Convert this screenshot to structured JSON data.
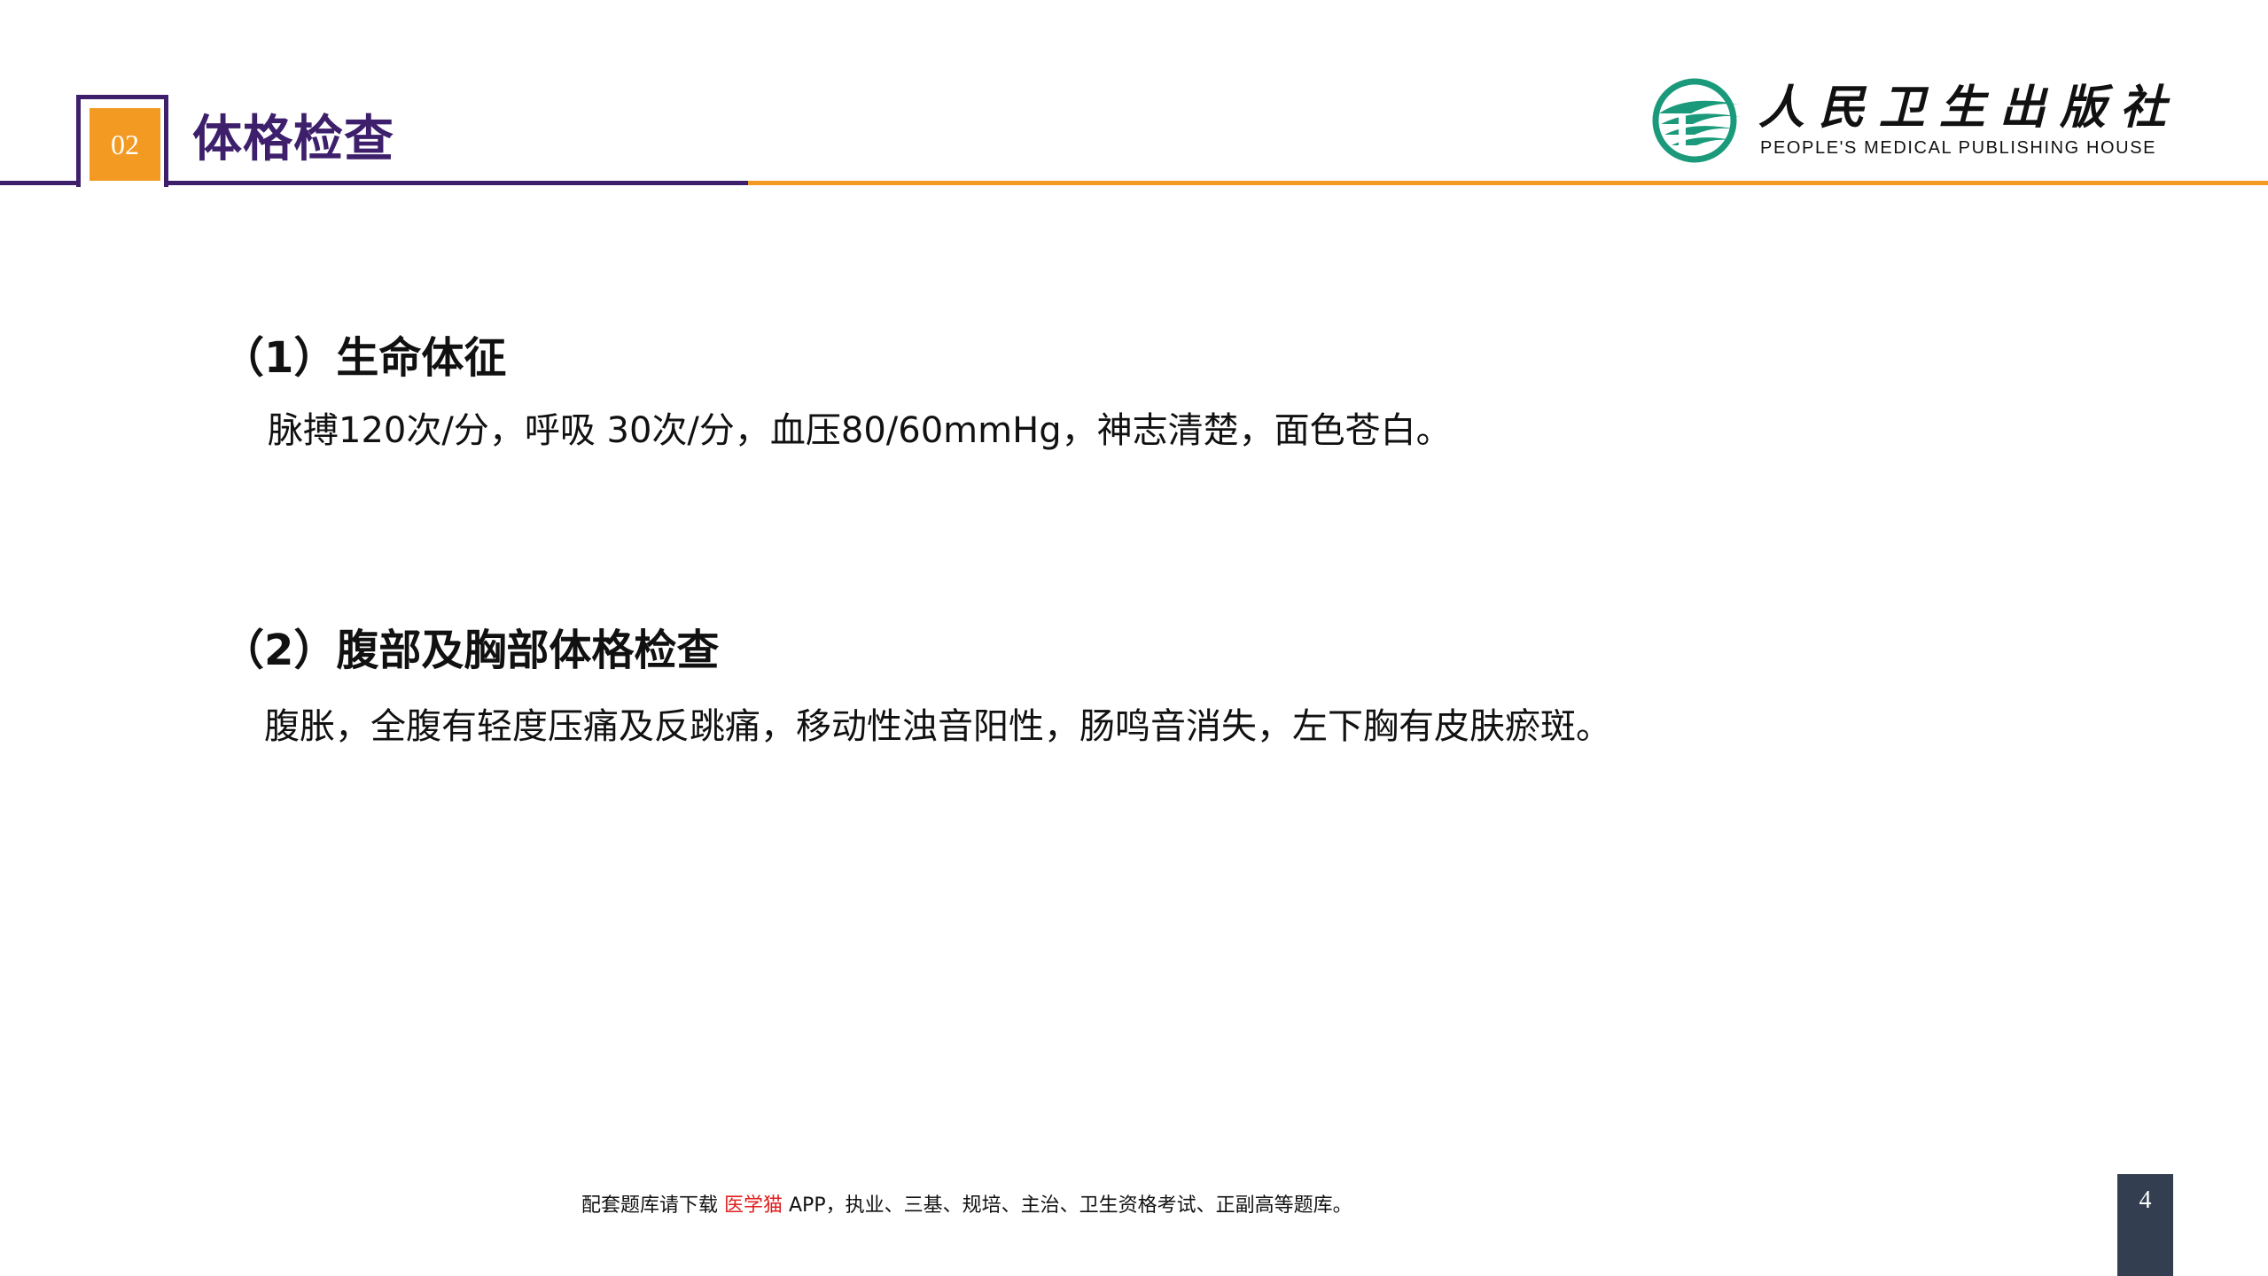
{
  "header": {
    "section_number": "02",
    "title": "体格检查"
  },
  "logo": {
    "name_cn": "人民卫生出版社",
    "name_en": "PEOPLE'S MEDICAL PUBLISHING HOUSE"
  },
  "sections": [
    {
      "heading": "（1）生命体征",
      "body": "脉搏120次/分，呼吸 30次/分，血压80/60mmHg，神志清楚，面色苍白。"
    },
    {
      "heading": "（2）腹部及胸部体格检查",
      "body": "腹胀，全腹有轻度压痛及反跳痛，移动性浊音阳性，肠鸣音消失，左下胸有皮肤瘀斑。"
    }
  ],
  "footer": {
    "prefix": "配套题库请下载 ",
    "highlight": "医学猫",
    "suffix": " APP，执业、三基、规培、主治、卫生资格考试、正副高等题库。"
  },
  "page_number": "4",
  "colors": {
    "purple": "#3d1f6b",
    "orange": "#f39a22",
    "logo_green": "#1a9a7a",
    "footer_highlight": "#e02020",
    "page_box": "#333f50"
  }
}
